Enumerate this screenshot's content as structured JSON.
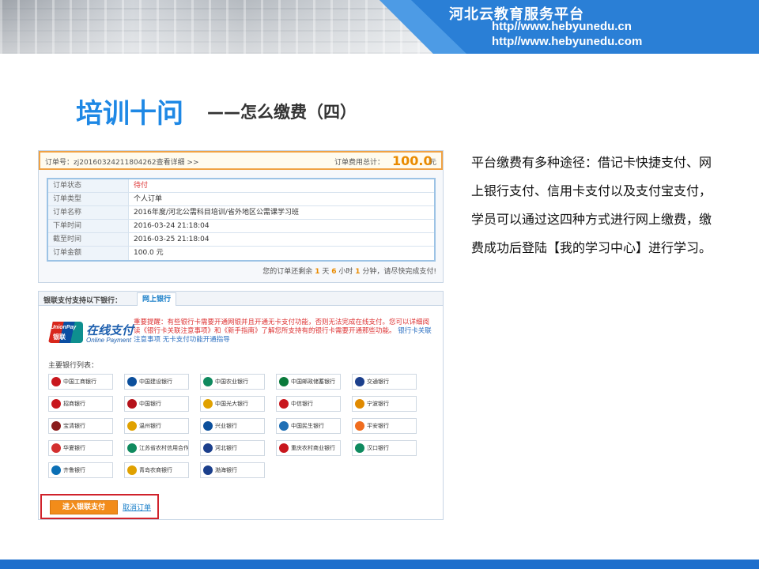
{
  "header": {
    "brand": "河北云教育服务平台",
    "url1": "http//www.hebyunedu.cn",
    "url2": "http//www.hebyunedu.com"
  },
  "title": {
    "main": "培训十问",
    "sub": "——怎么缴费（四）"
  },
  "description": "平台缴费有多种途径：借记卡快捷支付、网上银行支付、信用卡支付以及支付宝支付，学员可以通过这四种方式进行网上缴费，缴费成功后登陆【我的学习中心】进行学习。",
  "order": {
    "number_label": "订单号：zj20160324211804262查看详细 >>",
    "total_label": "订单费用总计：",
    "total_value": "100.0",
    "total_unit": "元",
    "rows": [
      {
        "key": "订单状态",
        "value": "待付"
      },
      {
        "key": "订单类型",
        "value": "个人订单"
      },
      {
        "key": "订单名称",
        "value": "2016年度/河北公需科目培训/省外地区公需课学习班"
      },
      {
        "key": "下单时间",
        "value": "2016-03-24 21:18:04"
      },
      {
        "key": "截至时间",
        "value": "2016-03-25 21:18:04"
      },
      {
        "key": "订单金额",
        "value": "100.0 元"
      }
    ],
    "remain": {
      "prefix": "您的订单还剩余",
      "days": "1",
      "days_unit": "天",
      "hours": "6",
      "hours_unit": "小时",
      "minutes": "1",
      "minutes_unit": "分钟，请尽快完成支付!"
    }
  },
  "pay": {
    "tab_label": "银联支付支持以下银行：",
    "tab_active": "网上银行",
    "logo_en": "UnionPay",
    "logo_cn": "银联",
    "online_cn": "在线支付",
    "online_en": "Online Payment",
    "notice_1": "重要提醒：有些银行卡需要开通网银并且开通无卡支付功能，否则无法完成在线支付。您可以详细阅读《银行卡关联注意事项》和《新手指南》了解您所支持有的银行卡需要开通那些功能。",
    "notice_link1": "银行卡关联注意事项",
    "notice_link2": "无卡支付功能开通指导",
    "bank_list_label": "主要银行列表：",
    "banks": [
      {
        "name": "中国工商银行",
        "color": "#c8161d"
      },
      {
        "name": "中国建设银行",
        "color": "#0b4f9c"
      },
      {
        "name": "中国农业银行",
        "color": "#0f8a5f"
      },
      {
        "name": "中国邮政储蓄银行",
        "color": "#0a7a3b"
      },
      {
        "name": "交通银行",
        "color": "#1b3f8c"
      },
      {
        "name": "招商银行",
        "color": "#c8161d"
      },
      {
        "name": "中国银行",
        "color": "#b5121b"
      },
      {
        "name": "中国光大银行",
        "color": "#e0a100"
      },
      {
        "name": "中信银行",
        "color": "#c8161d"
      },
      {
        "name": "宁波银行",
        "color": "#e08a00"
      },
      {
        "name": "宝清银行",
        "color": "#8a1c1c"
      },
      {
        "name": "温州银行",
        "color": "#e0a100"
      },
      {
        "name": "兴业银行",
        "color": "#0b4f9c"
      },
      {
        "name": "中国民生银行",
        "color": "#1f6fb5"
      },
      {
        "name": "平安银行",
        "color": "#f06d1f"
      },
      {
        "name": "华夏银行",
        "color": "#d32f2f"
      },
      {
        "name": "江苏省农村信用合作社",
        "color": "#0f8a5f"
      },
      {
        "name": "河北银行",
        "color": "#1b3f8c"
      },
      {
        "name": "重庆农村商业银行",
        "color": "#c8161d"
      },
      {
        "name": "汉口银行",
        "color": "#0f8a5f"
      },
      {
        "name": "齐鲁银行",
        "color": "#0b6fb5"
      },
      {
        "name": "青岛农商银行",
        "color": "#e0a100"
      },
      {
        "name": "渤海银行",
        "color": "#1b3f8c"
      }
    ],
    "pay_button": "进入银联支付",
    "cancel_link": "取消订单"
  },
  "colors": {
    "brand_blue": "#1e88e5",
    "accent_orange": "#f28c1a",
    "highlight_red": "#d0222b"
  }
}
